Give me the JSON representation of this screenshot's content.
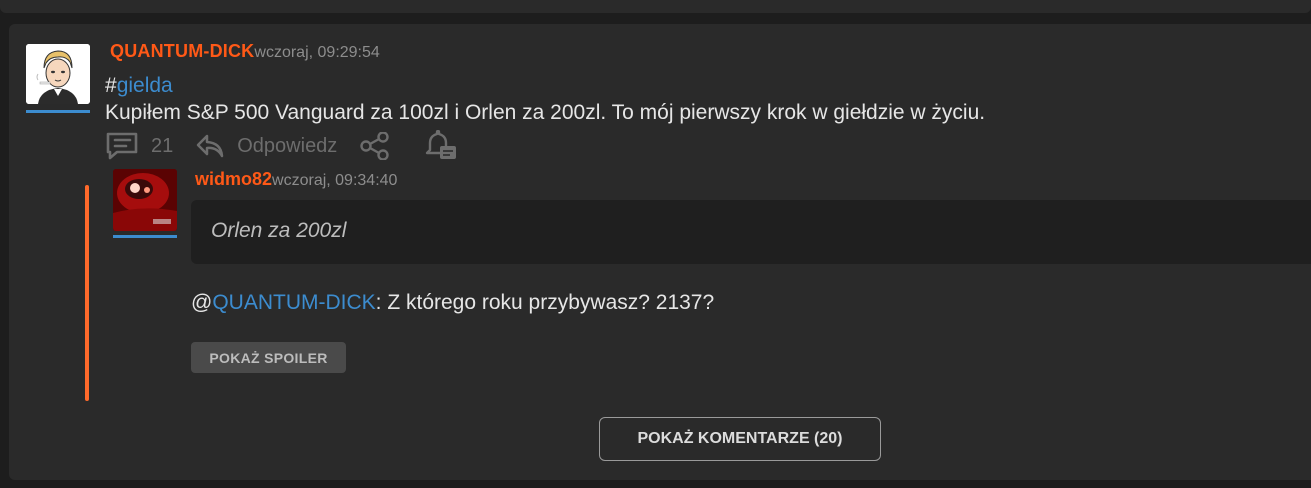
{
  "post": {
    "author": "QUANTUM-DICK",
    "timestamp": "wczoraj, 09:29:54",
    "hash": "#",
    "tag": "gielda",
    "body": "Kupiłem S&P 500 Vanguard za 100zl i Orlen za 200zl. To mój pierwszy krok w giełdzie w życiu.",
    "actions": {
      "comment_count": "21",
      "reply_label": "Odpowiedz"
    }
  },
  "reply": {
    "author": "widmo82",
    "timestamp": "wczoraj, 09:34:40",
    "quote": "Orlen za 200zl",
    "mention_prefix": "@",
    "mention": "QUANTUM-DICK",
    "text": ": Z którego roku przybywasz? 2137?",
    "spoiler_label": "POKAŻ SPOILER"
  },
  "show_comments_label": "POKAŻ KOMENTARZE (20)",
  "icons": {
    "comments": "comment-lines-icon",
    "reply": "reply-arrow-icon",
    "share": "share-icon",
    "notify": "bell-icon"
  },
  "colors": {
    "accent": "#ff5917",
    "link": "#3c8ccf",
    "thread_line": "#ff6a2b"
  }
}
